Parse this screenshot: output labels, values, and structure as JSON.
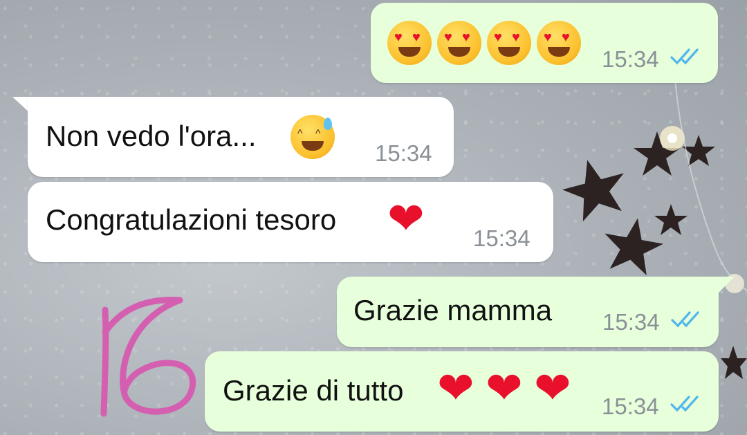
{
  "messages": [
    {
      "id": "m1",
      "direction": "outgoing",
      "content_emoji": [
        "heart-eyes-emoji",
        "heart-eyes-emoji",
        "heart-eyes-emoji",
        "heart-eyes-emoji"
      ],
      "time": "15:34",
      "status": "read"
    },
    {
      "id": "m2",
      "direction": "incoming",
      "text": "Non vedo l'ora...",
      "content_emoji": [
        "grinning-sweat-emoji"
      ],
      "time": "15:34"
    },
    {
      "id": "m3",
      "direction": "incoming",
      "text": "Congratulazioni tesoro",
      "content_emoji": [
        "red-heart-emoji"
      ],
      "time": "15:34"
    },
    {
      "id": "m4",
      "direction": "outgoing",
      "text": "Grazie mamma",
      "time": "15:34",
      "status": "read"
    },
    {
      "id": "m5",
      "direction": "outgoing",
      "text": "Grazie di tutto",
      "content_emoji": [
        "red-heart-emoji",
        "red-heart-emoji",
        "red-heart-emoji"
      ],
      "time": "15:34",
      "status": "read"
    }
  ],
  "overlay": {
    "handwritten_number": "16",
    "color": "#d45fb0"
  },
  "colors": {
    "outgoing_bubble": "#e7ffdb",
    "incoming_bubble": "#ffffff",
    "read_ticks": "#4fb6ec",
    "timestamp": "#8a9096"
  },
  "glyphs": {
    "heart": "❤",
    "heart_eye": "♥",
    "eye_smile": "^"
  }
}
